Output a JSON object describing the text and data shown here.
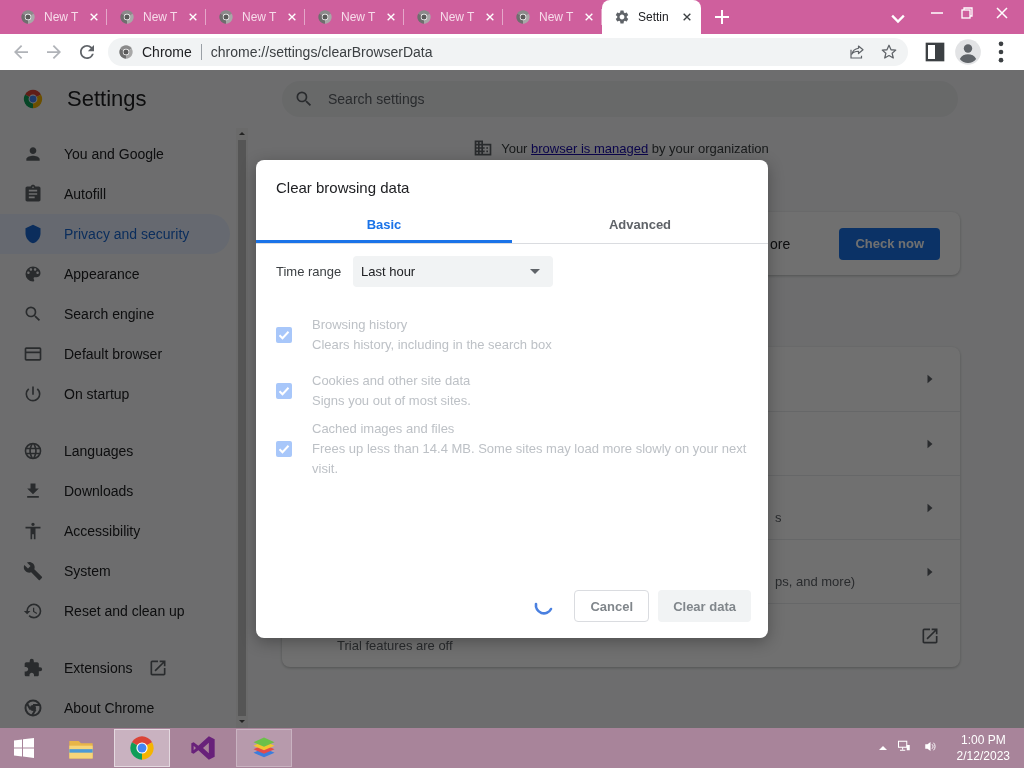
{
  "tabs": [
    {
      "title": "New T",
      "kind": "newtab",
      "selected": false
    },
    {
      "title": "New T",
      "kind": "newtab",
      "selected": false
    },
    {
      "title": "New T",
      "kind": "newtab",
      "selected": false
    },
    {
      "title": "New T",
      "kind": "newtab",
      "selected": false
    },
    {
      "title": "New T",
      "kind": "newtab",
      "selected": false
    },
    {
      "title": "New T",
      "kind": "newtab",
      "selected": false
    },
    {
      "title": "Settin",
      "kind": "settings",
      "selected": true
    }
  ],
  "address_bar": {
    "site_label": "Chrome",
    "url": "chrome://settings/clearBrowserData"
  },
  "page_title": "Settings",
  "search": {
    "placeholder": "Search settings"
  },
  "sidebar": {
    "sections": [
      {
        "items": [
          {
            "label": "You and Google",
            "selected": false,
            "external": false
          },
          {
            "label": "Autofill",
            "selected": false,
            "external": false
          },
          {
            "label": "Privacy and security",
            "selected": true,
            "external": false
          },
          {
            "label": "Appearance",
            "selected": false,
            "external": false
          },
          {
            "label": "Search engine",
            "selected": false,
            "external": false
          },
          {
            "label": "Default browser",
            "selected": false,
            "external": false
          },
          {
            "label": "On startup",
            "selected": false,
            "external": false
          }
        ]
      },
      {
        "items": [
          {
            "label": "Languages",
            "selected": false,
            "external": false
          },
          {
            "label": "Downloads",
            "selected": false,
            "external": false
          },
          {
            "label": "Accessibility",
            "selected": false,
            "external": false
          },
          {
            "label": "System",
            "selected": false,
            "external": false
          },
          {
            "label": "Reset and clean up",
            "selected": false,
            "external": false
          }
        ]
      },
      {
        "items": [
          {
            "label": "Extensions",
            "selected": false,
            "external": true
          },
          {
            "label": "About Chrome",
            "selected": false,
            "external": false
          }
        ]
      }
    ]
  },
  "managed_notice": {
    "before": "Your",
    "link": "browser is managed",
    "after": "by your organization"
  },
  "safety_card": {
    "text": "ore",
    "button": "Check now"
  },
  "settings_rows": [
    {
      "kind": "chevron"
    },
    {
      "kind": "chevron"
    },
    {
      "kind": "chevron",
      "text": "s"
    },
    {
      "kind": "chevron",
      "text": "ps, and more)"
    },
    {
      "kind": "external",
      "text": "Trial features are off"
    }
  ],
  "dialog": {
    "title": "Clear browsing data",
    "tabs": [
      {
        "label": "Basic",
        "selected": true
      },
      {
        "label": "Advanced",
        "selected": false
      }
    ],
    "time_range": {
      "label": "Time range",
      "value": "Last hour"
    },
    "options": [
      {
        "title": "Browsing history",
        "description": "Clears history, including in the search box",
        "checked": true,
        "disabled": true
      },
      {
        "title": "Cookies and other site data",
        "description": "Signs you out of most sites.",
        "checked": true,
        "disabled": true
      },
      {
        "title": "Cached images and files",
        "description": "Frees up less than 14.4 MB. Some sites may load more slowly on your next visit.",
        "checked": true,
        "disabled": true
      }
    ],
    "loading": true,
    "buttons": [
      {
        "label": "Cancel",
        "kind": "secondary",
        "disabled": true
      },
      {
        "label": "Clear data",
        "kind": "primary",
        "disabled": true
      }
    ]
  },
  "taskbar": {
    "apps": [
      {
        "kind": "explorer",
        "open": false,
        "selected": false
      },
      {
        "kind": "chrome",
        "open": true,
        "selected": true
      },
      {
        "kind": "visual-studio",
        "open": false,
        "selected": false
      },
      {
        "kind": "bluestacks",
        "open": true,
        "selected": false
      }
    ],
    "clock": {
      "time": "1:00 PM",
      "date": "2/12/2023"
    }
  }
}
